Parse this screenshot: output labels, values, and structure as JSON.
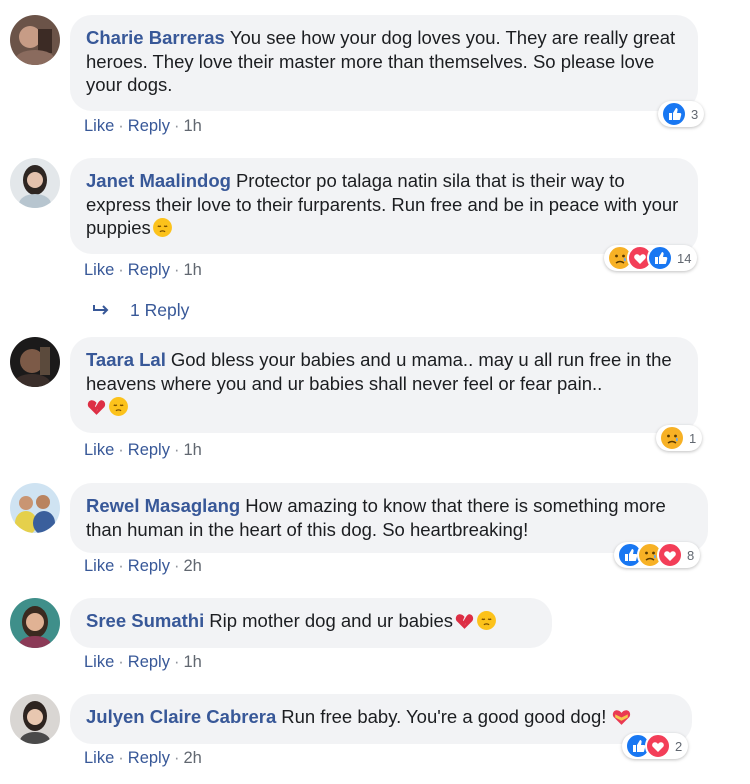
{
  "comments": [
    {
      "author": "Charie Barreras",
      "text": "You see how your dog loves you. They are really great heroes. They love their master more than themselves. So please love your dogs.",
      "like": "Like",
      "reply": "Reply",
      "time": "1h",
      "reactions": [
        "like"
      ],
      "reaction_count": "3"
    },
    {
      "author": "Janet Maalindog",
      "text": "Protector po talaga natin sila that is their way to express their love to their furparents. Run free and be in peace with your puppies",
      "emojis": [
        "pensive-face"
      ],
      "like": "Like",
      "reply": "Reply",
      "time": "1h",
      "reactions": [
        "sad",
        "love",
        "like"
      ],
      "reaction_count": "14"
    },
    {
      "author": "Taara Lal",
      "text": "God bless your babies and u mama.. may u all run free in the heavens where you and ur babies shall never feel or fear pain..",
      "emojis": [
        "broken-heart",
        "pensive-face"
      ],
      "like": "Like",
      "reply": "Reply",
      "time": "1h",
      "reactions": [
        "sad"
      ],
      "reaction_count": "1"
    },
    {
      "author": "Rewel Masaglang",
      "text": "How amazing to know that there is something more than human in the heart of this dog. So heartbreaking!",
      "like": "Like",
      "reply": "Reply",
      "time": "2h",
      "reactions": [
        "like",
        "sad",
        "love"
      ],
      "reaction_count": "8"
    },
    {
      "author": "Sree Sumathi",
      "text": "Rip mother dog and ur babies",
      "emojis": [
        "broken-heart",
        "pensive-face"
      ],
      "like": "Like",
      "reply": "Reply",
      "time": "1h"
    },
    {
      "author": "Julyen Claire Cabrera",
      "text": "Run free baby. You're a good good dog!",
      "emojis": [
        "heart-with-ribbon"
      ],
      "like": "Like",
      "reply": "Reply",
      "time": "2h",
      "reactions": [
        "like",
        "love"
      ],
      "reaction_count": "2"
    }
  ],
  "view_replies": "1 Reply",
  "colors": {
    "author": "#385898",
    "link": "#385898",
    "bubble": "#f2f3f5",
    "like": "#1877f2",
    "love": "#f33e58",
    "sad": "#f7b125"
  }
}
